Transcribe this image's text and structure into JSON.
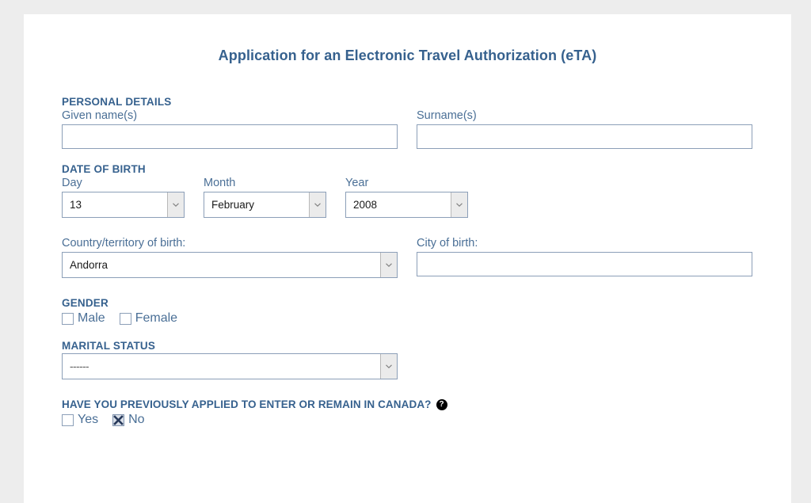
{
  "form": {
    "title": "Application for an Electronic Travel Authorization (eTA)",
    "personal_details": {
      "heading": "PERSONAL DETAILS",
      "given_name": {
        "label": "Given name(s)",
        "value": "",
        "placeholder": ""
      },
      "surname": {
        "label": "Surname(s)",
        "value": "",
        "placeholder": ""
      }
    },
    "date_of_birth": {
      "heading": "DATE OF BIRTH",
      "day": {
        "label": "Day",
        "value": "13"
      },
      "month": {
        "label": "Month",
        "value": "February"
      },
      "year": {
        "label": "Year",
        "value": "2008"
      }
    },
    "birth_place": {
      "country": {
        "label": "Country/territory of birth:",
        "value": "Andorra"
      },
      "city": {
        "label": "City of birth:",
        "value": "",
        "placeholder": ""
      }
    },
    "gender": {
      "heading": "GENDER",
      "options": [
        {
          "label": "Male",
          "checked": false
        },
        {
          "label": "Female",
          "checked": false
        }
      ]
    },
    "marital_status": {
      "heading": "MARITAL STATUS",
      "value": "------"
    },
    "previous_application": {
      "question": "HAVE YOU PREVIOUSLY APPLIED TO ENTER OR REMAIN IN CANADA?",
      "help_glyph": "?",
      "options": [
        {
          "label": "Yes",
          "checked": false
        },
        {
          "label": "No",
          "checked": true
        }
      ]
    }
  },
  "colors": {
    "heading": "#36618e",
    "label": "#4a6f96",
    "border": "#8c9fb8",
    "page_background": "#ededed",
    "panel": "#ffffff"
  }
}
